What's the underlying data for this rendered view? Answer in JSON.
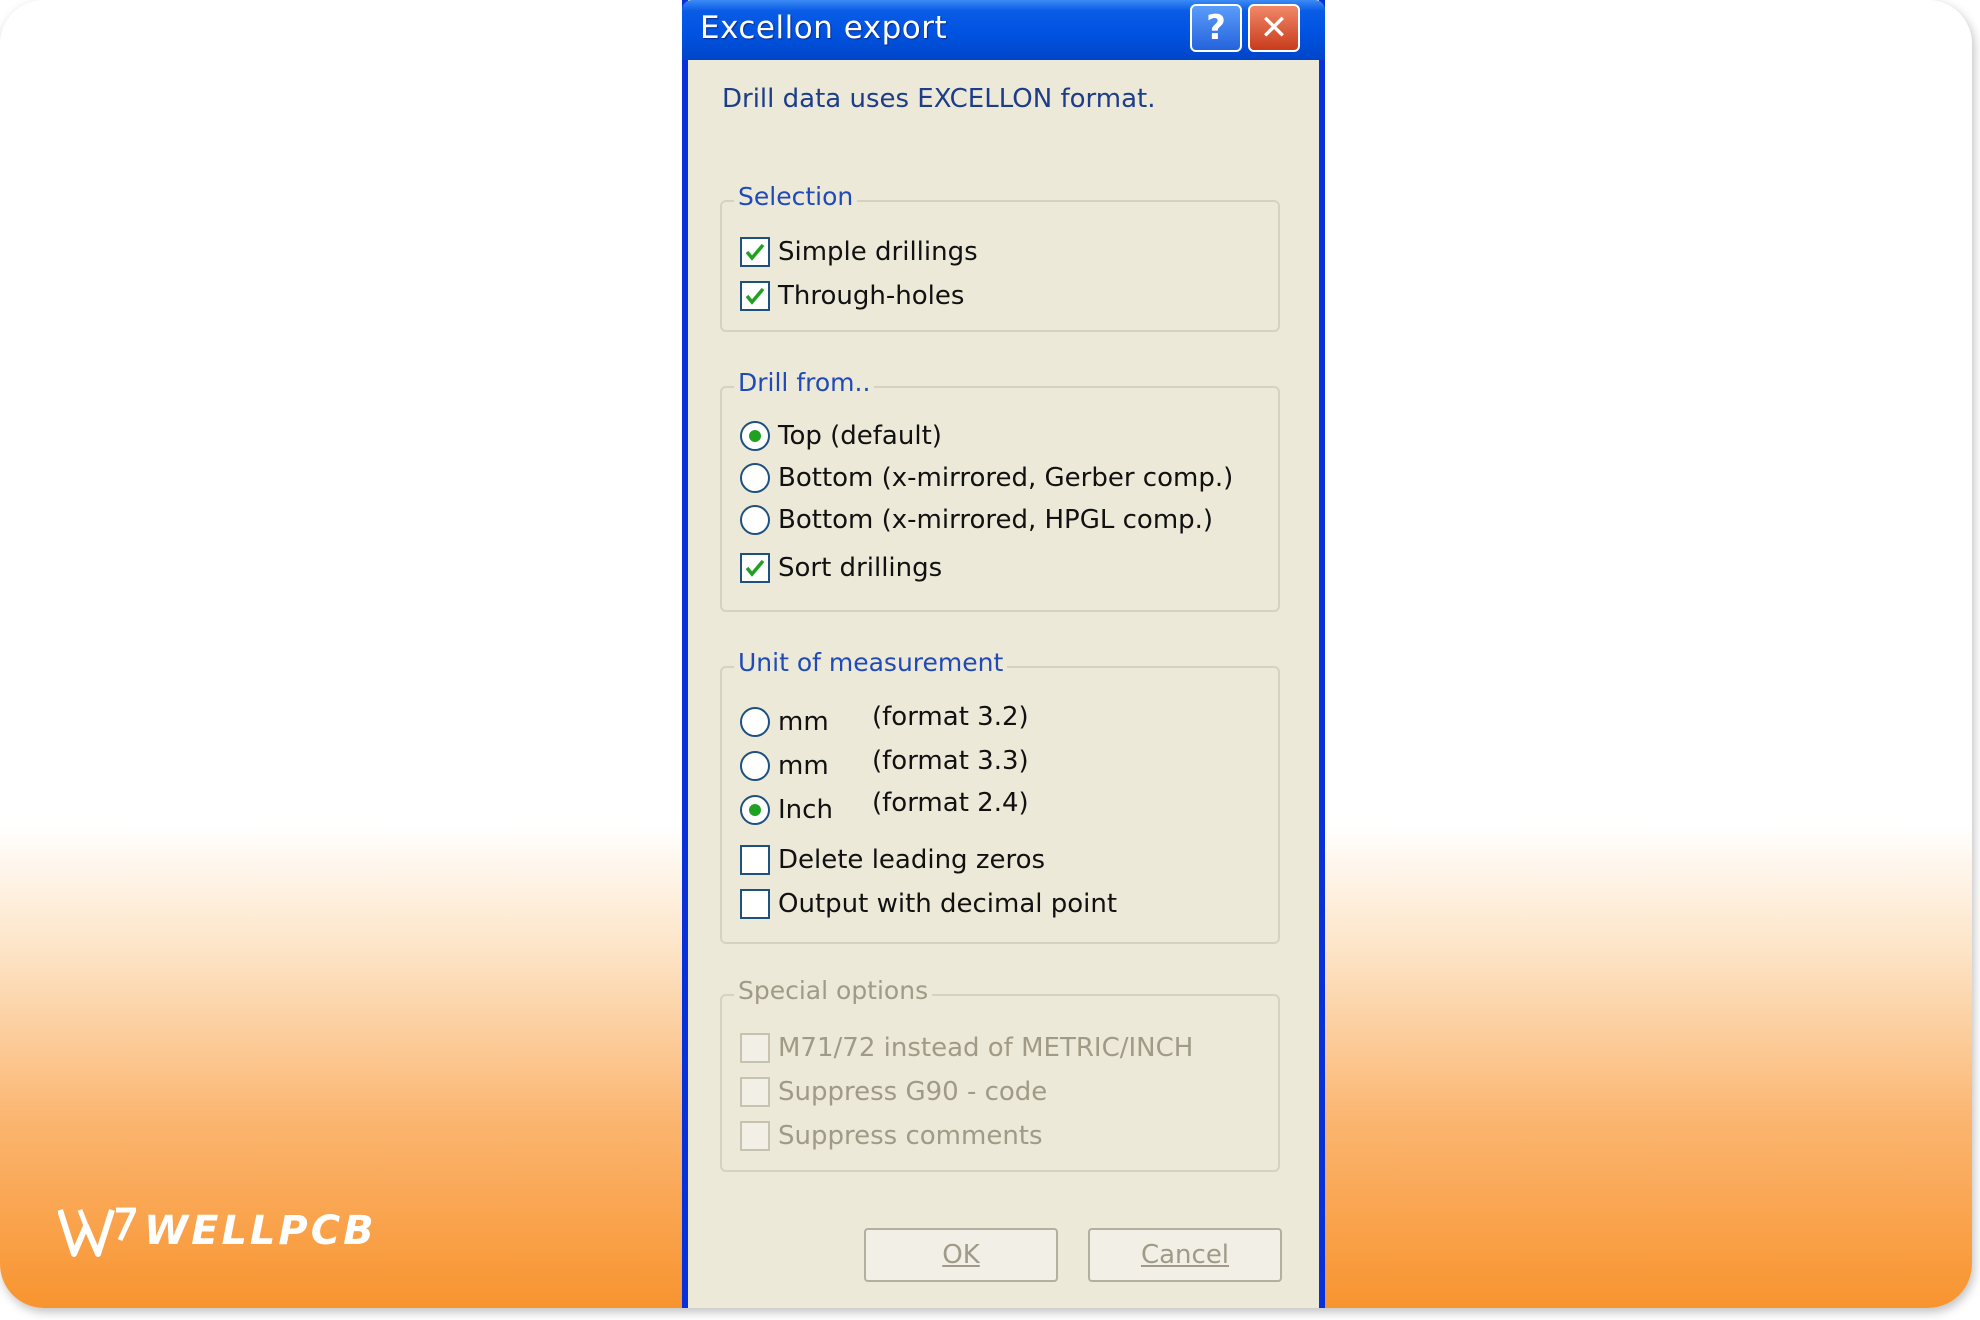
{
  "window": {
    "title": "Excellon export",
    "help_glyph": "?",
    "close_glyph": "✕"
  },
  "description": "Drill data uses EXCELLON format.",
  "selection": {
    "title": "Selection",
    "items": [
      {
        "label": "Simple drillings",
        "checked": true
      },
      {
        "label": "Through-holes",
        "checked": true
      }
    ]
  },
  "drill_from": {
    "title": "Drill from..",
    "options": [
      {
        "label": "Top (default)",
        "selected": true
      },
      {
        "label": "Bottom (x-mirrored, Gerber comp.)",
        "selected": false
      },
      {
        "label": "Bottom (x-mirrored, HPGL comp.)",
        "selected": false
      }
    ],
    "sort": {
      "label": "Sort drillings",
      "checked": true
    }
  },
  "unit": {
    "title": "Unit of measurement",
    "options": [
      {
        "label": "mm",
        "format": "(format 3.2)",
        "selected": false
      },
      {
        "label": "mm",
        "format": "(format 3.3)",
        "selected": false
      },
      {
        "label": "Inch",
        "format": "(format 2.4)",
        "selected": true
      }
    ],
    "checks": [
      {
        "label": "Delete leading zeros",
        "checked": false
      },
      {
        "label": "Output with decimal point",
        "checked": false
      }
    ]
  },
  "special": {
    "title": "Special options",
    "checks": [
      {
        "label": "M71/72 instead of METRIC/INCH",
        "checked": false
      },
      {
        "label": "Suppress G90 - code",
        "checked": false
      },
      {
        "label": "Suppress comments",
        "checked": false
      }
    ]
  },
  "buttons": {
    "ok": "OK",
    "cancel": "Cancel"
  },
  "watermark": {
    "text": "WELLPCB"
  },
  "colors": {
    "title_bar": "#0053e1",
    "group_title": "#1f4ab8",
    "check_mark": "#21a121",
    "background_gradient_end": "#f8942f"
  }
}
